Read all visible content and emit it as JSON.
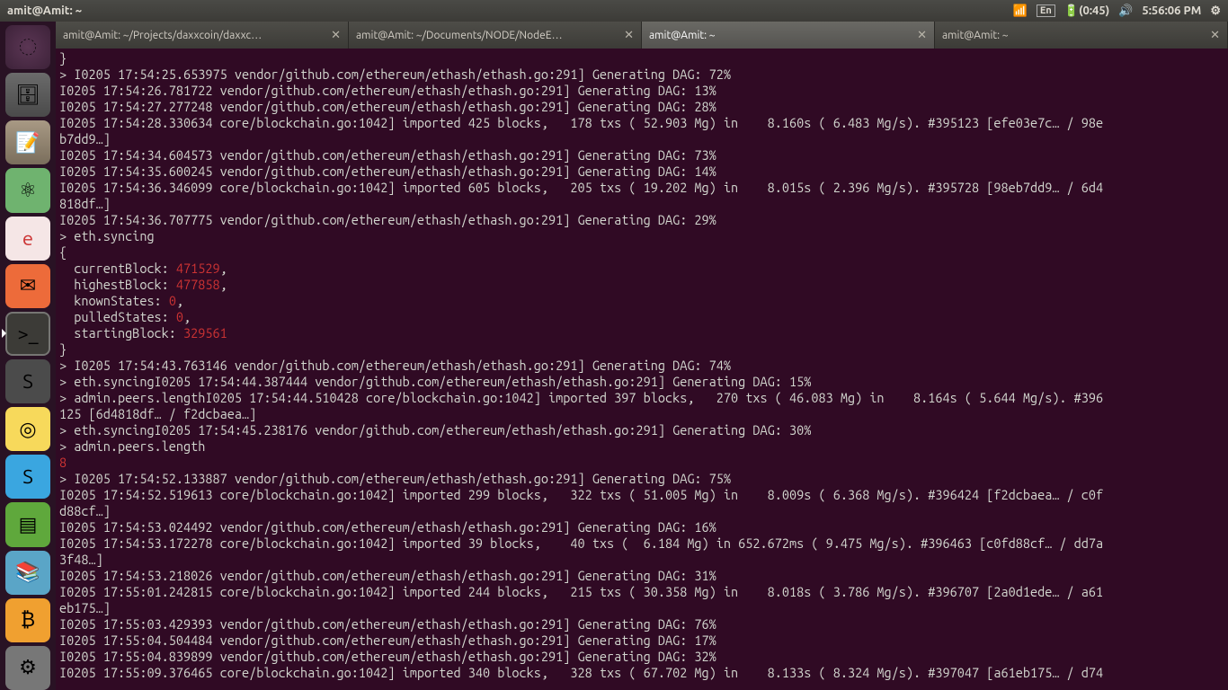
{
  "topbar": {
    "title": "amit@Amit: ~",
    "wifi_icon": "📶",
    "lang": "En",
    "battery_icon": "🔋",
    "battery_time": "(0:45)",
    "volume_icon": "🔊",
    "time": "5:56:06 PM",
    "gear_icon": "⚙"
  },
  "launcher": [
    {
      "name": "dash",
      "cls": "li-dash",
      "glyph": "◌"
    },
    {
      "name": "files",
      "cls": "li-files",
      "glyph": "🗄"
    },
    {
      "name": "gedit",
      "cls": "li-gedit",
      "glyph": "📝"
    },
    {
      "name": "atom",
      "cls": "li-atom",
      "glyph": "⚛"
    },
    {
      "name": "pdf",
      "cls": "li-pdf",
      "glyph": "e"
    },
    {
      "name": "postman",
      "cls": "li-postman",
      "glyph": "✉"
    },
    {
      "name": "terminal",
      "cls": "li-term",
      "glyph": ">_",
      "arrow": true
    },
    {
      "name": "sublime",
      "cls": "li-sublime",
      "glyph": "S"
    },
    {
      "name": "chrome",
      "cls": "li-chrome",
      "glyph": "◎"
    },
    {
      "name": "skype",
      "cls": "li-skype",
      "glyph": "S"
    },
    {
      "name": "green",
      "cls": "li-green",
      "glyph": "▤"
    },
    {
      "name": "books",
      "cls": "li-books",
      "glyph": "📚"
    },
    {
      "name": "bitcoin",
      "cls": "li-btc",
      "glyph": "₿"
    },
    {
      "name": "gear",
      "cls": "li-gear",
      "glyph": "⚙"
    }
  ],
  "tabs": [
    {
      "label": "amit@Amit: ~/Projects/daxxcoin/daxxc…",
      "active": false
    },
    {
      "label": "amit@Amit: ~/Documents/NODE/NodeE…",
      "active": false
    },
    {
      "label": "amit@Amit: ~",
      "active": true
    },
    {
      "label": "amit@Amit: ~",
      "active": false
    }
  ],
  "lines": [
    {
      "t": "}"
    },
    {
      "t": "> I0205 17:54:25.653975 vendor/github.com/ethereum/ethash/ethash.go:291] Generating DAG: 72%"
    },
    {
      "t": "I0205 17:54:26.781722 vendor/github.com/ethereum/ethash/ethash.go:291] Generating DAG: 13%"
    },
    {
      "t": "I0205 17:54:27.277248 vendor/github.com/ethereum/ethash/ethash.go:291] Generating DAG: 28%"
    },
    {
      "t": "I0205 17:54:28.330634 core/blockchain.go:1042] imported 425 blocks,   178 txs ( 52.903 Mg) in    8.160s ( 6.483 Mg/s). #395123 [efe03e7c… / 98e"
    },
    {
      "t": "b7dd9…]"
    },
    {
      "t": "I0205 17:54:34.604573 vendor/github.com/ethereum/ethash/ethash.go:291] Generating DAG: 73%"
    },
    {
      "t": "I0205 17:54:35.600245 vendor/github.com/ethereum/ethash/ethash.go:291] Generating DAG: 14%"
    },
    {
      "t": "I0205 17:54:36.346099 core/blockchain.go:1042] imported 605 blocks,   205 txs ( 19.202 Mg) in    8.015s ( 2.396 Mg/s). #395728 [98eb7dd9… / 6d4"
    },
    {
      "t": "818df…]"
    },
    {
      "t": "I0205 17:54:36.707775 vendor/github.com/ethereum/ethash/ethash.go:291] Generating DAG: 29%"
    },
    {
      "t": "> eth.syncing"
    },
    {
      "t": "{"
    },
    {
      "t": "  currentBlock: ",
      "r": "471529",
      "s": ","
    },
    {
      "t": "  highestBlock: ",
      "r": "477858",
      "s": ","
    },
    {
      "t": "  knownStates: ",
      "r": "0",
      "s": ","
    },
    {
      "t": "  pulledStates: ",
      "r": "0",
      "s": ","
    },
    {
      "t": "  startingBlock: ",
      "r": "329561"
    },
    {
      "t": "}"
    },
    {
      "t": "> I0205 17:54:43.763146 vendor/github.com/ethereum/ethash/ethash.go:291] Generating DAG: 74%"
    },
    {
      "t": "> eth.syncingI0205 17:54:44.387444 vendor/github.com/ethereum/ethash/ethash.go:291] Generating DAG: 15%"
    },
    {
      "t": "> admin.peers.lengthI0205 17:54:44.510428 core/blockchain.go:1042] imported 397 blocks,   270 txs ( 46.083 Mg) in    8.164s ( 5.644 Mg/s). #396"
    },
    {
      "t": "125 [6d4818df… / f2dcbaea…]"
    },
    {
      "t": "> eth.syncingI0205 17:54:45.238176 vendor/github.com/ethereum/ethash/ethash.go:291] Generating DAG: 30%"
    },
    {
      "t": "> admin.peers.length"
    },
    {
      "r": "8"
    },
    {
      "t": "> I0205 17:54:52.133887 vendor/github.com/ethereum/ethash/ethash.go:291] Generating DAG: 75%"
    },
    {
      "t": "I0205 17:54:52.519613 core/blockchain.go:1042] imported 299 blocks,   322 txs ( 51.005 Mg) in    8.009s ( 6.368 Mg/s). #396424 [f2dcbaea… / c0f"
    },
    {
      "t": "d88cf…]"
    },
    {
      "t": "I0205 17:54:53.024492 vendor/github.com/ethereum/ethash/ethash.go:291] Generating DAG: 16%"
    },
    {
      "t": "I0205 17:54:53.172278 core/blockchain.go:1042] imported 39 blocks,    40 txs (  6.184 Mg) in 652.672ms ( 9.475 Mg/s). #396463 [c0fd88cf… / dd7a"
    },
    {
      "t": "3f48…]"
    },
    {
      "t": "I0205 17:54:53.218026 vendor/github.com/ethereum/ethash/ethash.go:291] Generating DAG: 31%"
    },
    {
      "t": "I0205 17:55:01.242815 core/blockchain.go:1042] imported 244 blocks,   215 txs ( 30.358 Mg) in    8.018s ( 3.786 Mg/s). #396707 [2a0d1ede… / a61"
    },
    {
      "t": "eb175…]"
    },
    {
      "t": "I0205 17:55:03.429393 vendor/github.com/ethereum/ethash/ethash.go:291] Generating DAG: 76%"
    },
    {
      "t": "I0205 17:55:04.504484 vendor/github.com/ethereum/ethash/ethash.go:291] Generating DAG: 17%"
    },
    {
      "t": "I0205 17:55:04.839899 vendor/github.com/ethereum/ethash/ethash.go:291] Generating DAG: 32%"
    },
    {
      "t": "I0205 17:55:09.376465 core/blockchain.go:1042] imported 340 blocks,   328 txs ( 67.702 Mg) in    8.133s ( 8.324 Mg/s). #397047 [a61eb175… / d74"
    }
  ]
}
